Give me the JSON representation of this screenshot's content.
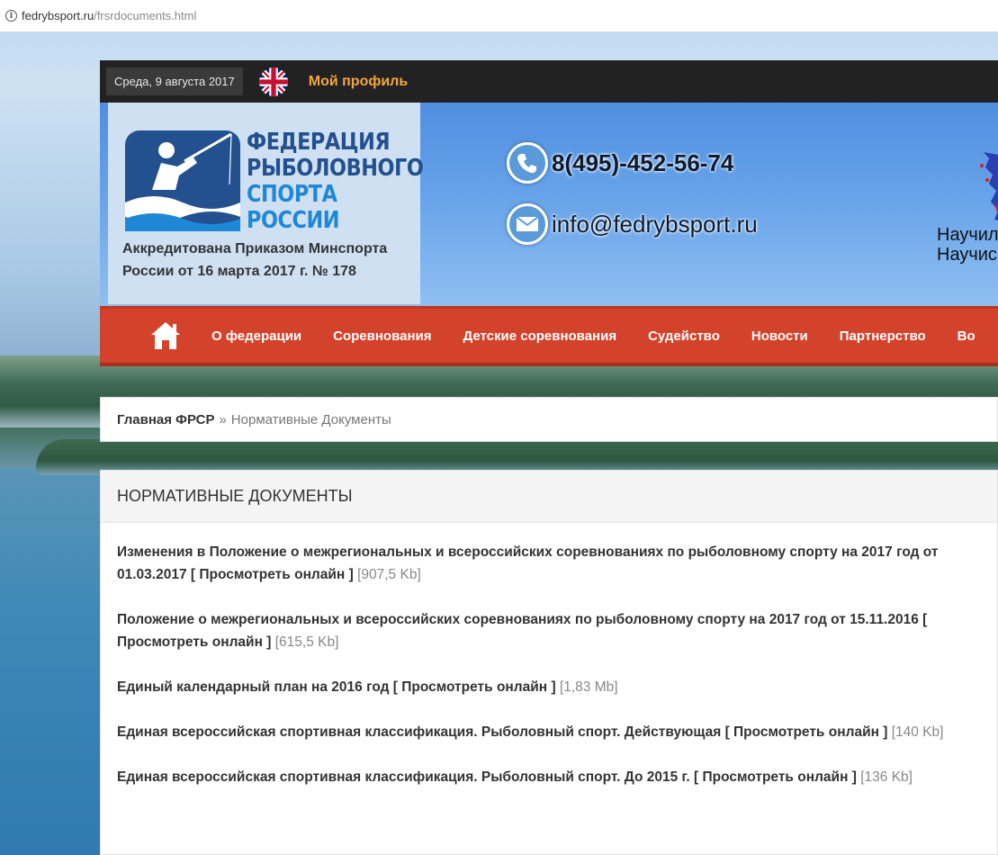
{
  "browser": {
    "url_domain": "fedrybsport.ru",
    "url_path": "/frsrdocuments.html"
  },
  "topbar": {
    "date": "Среда, 9 августа 2017",
    "profile_label": "Мой профиль"
  },
  "header": {
    "logo_lines": [
      "ФЕДЕРАЦИЯ",
      "РЫБОЛОВНОГО",
      "СПОРТА",
      "РОССИИ"
    ],
    "accreditation_line1": "Аккредитована Приказом Минспорта",
    "accreditation_line2": "России от 16 марта 2017 г. № 178",
    "phone": "8(495)-452-56-74",
    "email": "info@fedrybsport.ru",
    "slogan_line1": "Научил",
    "slogan_line2": "Научись"
  },
  "nav": {
    "items": [
      {
        "label": "О федерации"
      },
      {
        "label": "Соревнования"
      },
      {
        "label": "Детские соревнования"
      },
      {
        "label": "Судейство"
      },
      {
        "label": "Новости"
      },
      {
        "label": "Партнерство"
      },
      {
        "label": "Во"
      }
    ]
  },
  "breadcrumb": {
    "home": "Главная ФРСР",
    "separator": "»",
    "current": "Нормативные Документы"
  },
  "content": {
    "title": "НОРМАТИВНЫЕ ДОКУМЕНТЫ",
    "view_label": "[ Просмотреть онлайн ]",
    "documents": [
      {
        "title": "Изменения в Положение о межрегиональных и всероссийских соревнованиях по рыболовному спорту на 2017 год от 01.03.2017",
        "size": "[907,5 Kb]"
      },
      {
        "title": "Положение о межрегиональных и всероссийских соревнованиях по рыболовному спорту на 2017 год от 15.11.2016",
        "size": "[615,5 Kb]"
      },
      {
        "title": "Единый календарный план на 2016 год",
        "size": "[1,83 Mb]"
      },
      {
        "title": "Единая всероссийская спортивная классификация. Рыболовный спорт. Действующая",
        "size": "[140 Kb]"
      },
      {
        "title": "Единая всероссийская спортивная классификация. Рыболовный спорт. До 2015 г.",
        "size": "[136 Kb]"
      }
    ]
  },
  "colors": {
    "nav_red": "#d3432c",
    "topbar_dark": "#222222",
    "profile_orange": "#f3a640",
    "logo_dark_blue": "#23508f",
    "logo_light_blue": "#1f88d6"
  },
  "icons": [
    "info-icon",
    "uk-flag-icon",
    "phone-icon",
    "email-icon",
    "home-icon",
    "russia-map-icon"
  ]
}
